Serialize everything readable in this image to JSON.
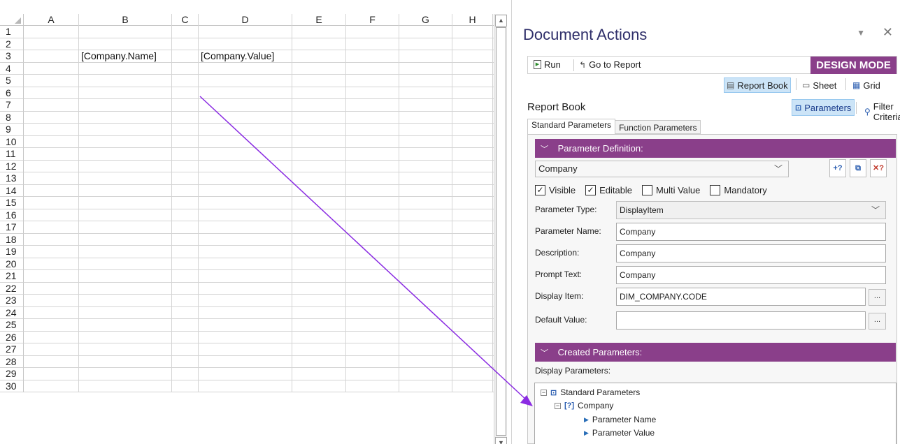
{
  "sheet": {
    "columns": [
      "A",
      "B",
      "C",
      "D",
      "E",
      "F",
      "G",
      "H"
    ],
    "rows": [
      "1",
      "2",
      "3",
      "4",
      "5",
      "6",
      "7",
      "8",
      "9",
      "10",
      "11",
      "12",
      "13",
      "14",
      "15",
      "16",
      "17",
      "18",
      "19",
      "20",
      "21",
      "22",
      "23",
      "24",
      "25",
      "26",
      "27",
      "28",
      "29",
      "30"
    ],
    "cells": {
      "B3": "[Company.Name]",
      "D3": "[Company.Value]"
    },
    "scroll_up": "▲",
    "scroll_down": "▼"
  },
  "pane": {
    "title": "Document Actions",
    "menu_glyph": "▼",
    "close_glyph": "✕",
    "toolbar": {
      "run_label": "Run",
      "goto_label": "Go to Report",
      "design_mode": "DESIGN MODE"
    },
    "views": {
      "report_book": "Report Book",
      "sheet": "Sheet",
      "grid": "Grid"
    },
    "report_book_label": "Report Book",
    "parameters_label": "Parameters",
    "filter_criteria_label": "Filter Criteria",
    "tabs": [
      "Standard Parameters",
      "Function Parameters"
    ],
    "param_def": {
      "header": "Parameter Definition:",
      "selected": "Company",
      "checks": [
        {
          "label": "Visible",
          "checked": true
        },
        {
          "label": "Editable",
          "checked": true
        },
        {
          "label": "Multi Value",
          "checked": false
        },
        {
          "label": "Mandatory",
          "checked": false
        }
      ],
      "fields": {
        "type_label": "Parameter Type:",
        "type_value": "DisplayItem",
        "name_label": "Parameter Name:",
        "name_value": "Company",
        "desc_label": "Description:",
        "desc_value": "Company",
        "prompt_label": "Prompt Text:",
        "prompt_value": "Company",
        "display_label": "Display Item:",
        "display_value": "DIM_COMPANY.CODE",
        "default_label": "Default Value:",
        "default_value": ""
      },
      "ellipsis": "..."
    },
    "created": {
      "header": "Created Parameters:",
      "display_label": "Display Parameters:",
      "tree": {
        "root": "Standard Parameters",
        "child": "Company",
        "leaves": [
          "Parameter Name",
          "Parameter Value"
        ]
      }
    }
  },
  "colors": {
    "accent": "#8a3f8a",
    "arrow": "#8a2be2",
    "title": "#2f2f6a"
  }
}
